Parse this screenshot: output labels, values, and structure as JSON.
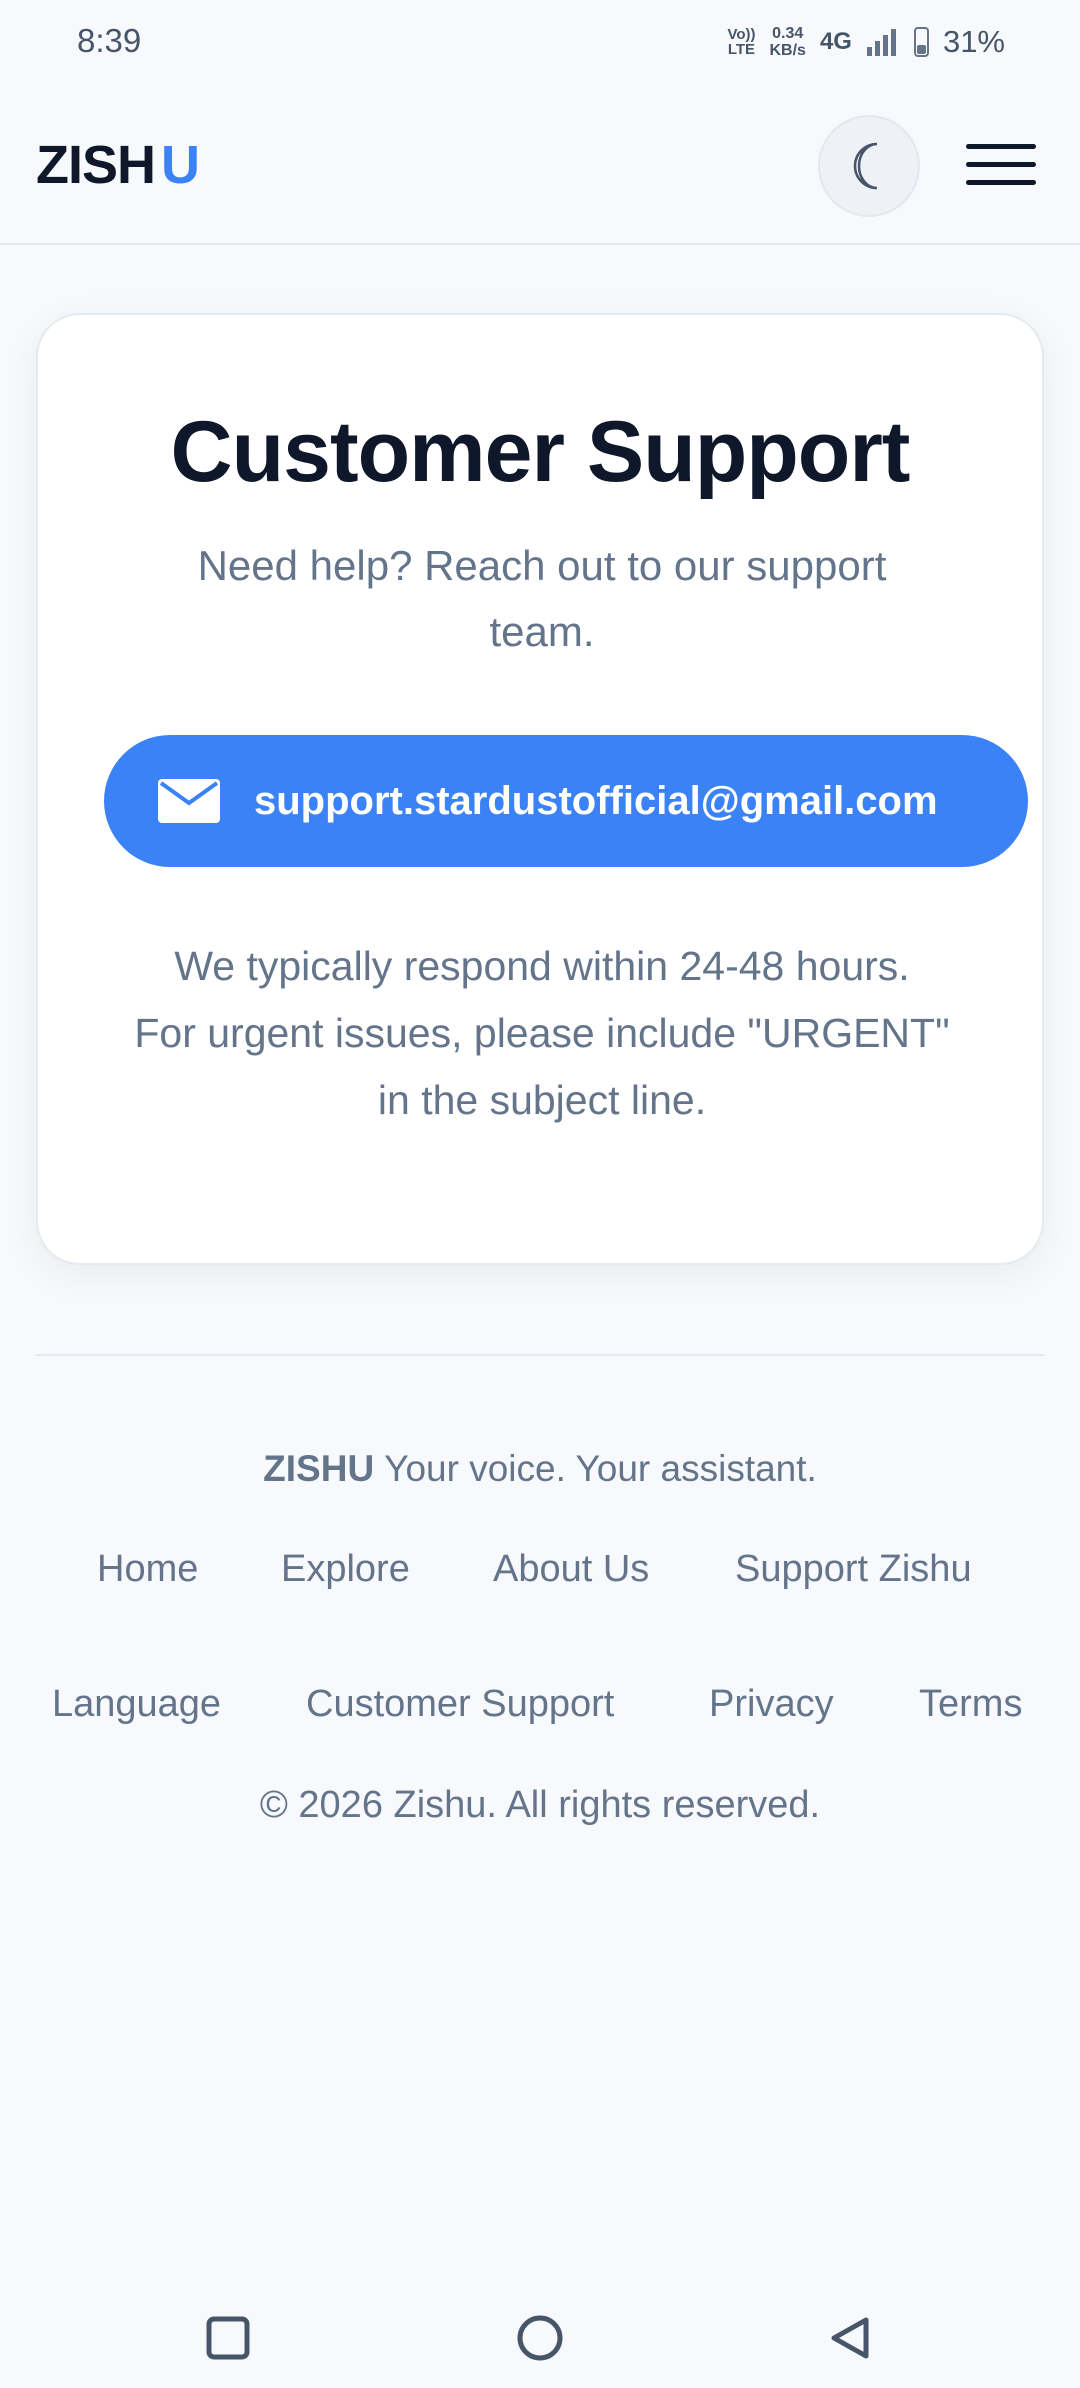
{
  "status_bar": {
    "time": "8:39",
    "volte_top": "Vo))",
    "volte_bottom": "LTE",
    "speed_value": "0.34",
    "speed_unit": "KB/s",
    "network": "4G",
    "battery": "31%"
  },
  "header": {
    "logo_main": "ZISH",
    "logo_accent": "U",
    "accent_color": "#3b82f6",
    "theme_icon": "moon-icon",
    "menu_icon": "hamburger-menu-icon"
  },
  "card": {
    "title": "Customer Support",
    "subtitle_line1": "Need help? Reach out to our support",
    "subtitle_line2": "team.",
    "email": "support.stardustofficial@gmail.com",
    "email_icon": "mail-icon",
    "note_line1": "We typically respond within 24-48 hours.",
    "note_line2": "For urgent issues, please include \"URGENT\"",
    "note_line3": "in the subject line."
  },
  "footer": {
    "brand": "ZISHU",
    "tagline": "Your voice. Your assistant.",
    "links_row1": [
      "Home",
      "Explore",
      "About Us",
      "Support Zishu"
    ],
    "links_row2": [
      "Language",
      "Customer Support",
      "Privacy",
      "Terms"
    ],
    "copyright": "© 2026 Zishu. All rights reserved."
  },
  "nav_bar": {
    "recents_icon": "square-recents-icon",
    "home_icon": "circle-home-icon",
    "back_icon": "triangle-back-icon"
  }
}
